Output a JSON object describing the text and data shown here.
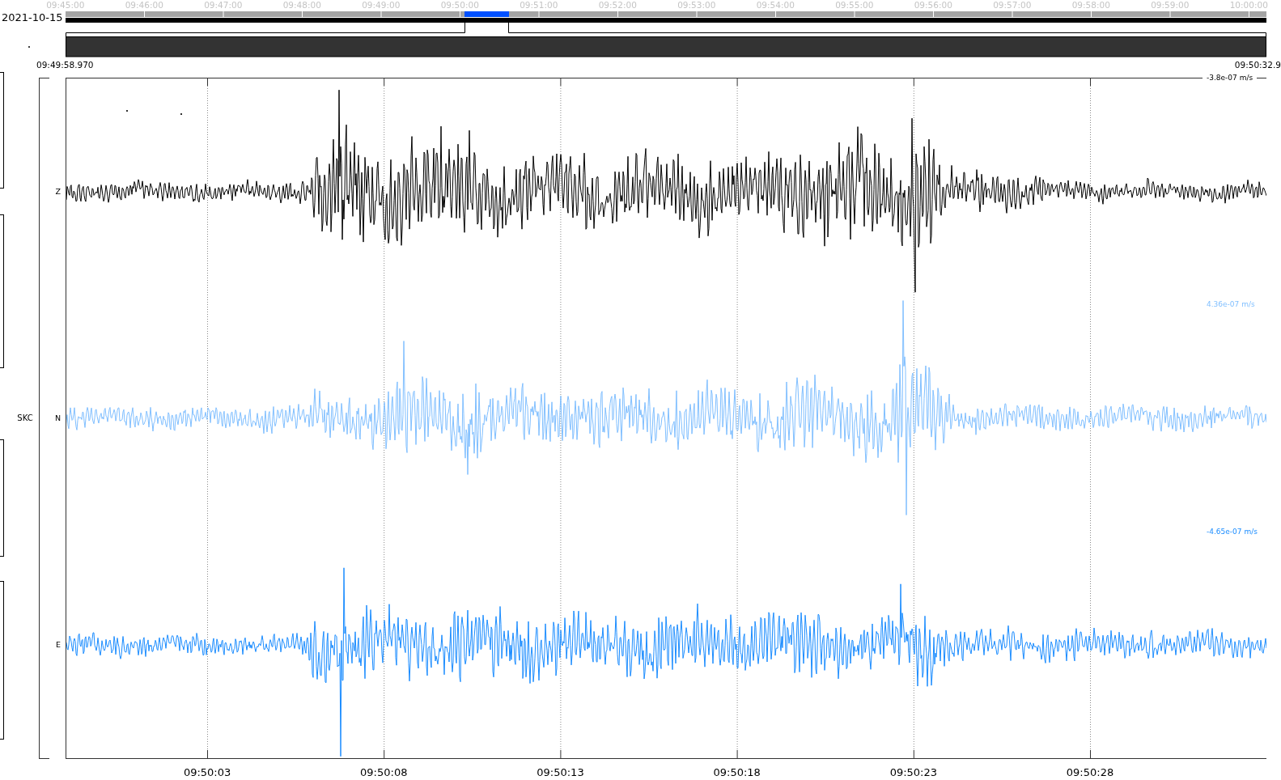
{
  "overview": {
    "date": "2021-10-15",
    "time_labels": [
      "09:45:00",
      "09:46:00",
      "09:47:00",
      "09:48:00",
      "09:49:00",
      "09:50:00",
      "09:51:00",
      "09:52:00",
      "09:53:00",
      "09:54:00",
      "09:55:00",
      "09:56:00",
      "09:57:00",
      "09:58:00",
      "09:59:00",
      "10:00:00"
    ]
  },
  "view": {
    "start_time": "09:49:58.970",
    "end_time": "09:50:32.9"
  },
  "station": {
    "name": "SKC"
  },
  "traces": [
    {
      "channel": "Z",
      "color": "#000000",
      "scale_label": "-3.8e-07 m/s"
    },
    {
      "channel": "N",
      "color": "#80bfff",
      "scale_label": "4.36e-07 m/s"
    },
    {
      "channel": "E",
      "color": "#1a8cff",
      "scale_label": "-4.65e-07 m/s"
    }
  ],
  "time_axis": {
    "ticks": [
      "09:50:03",
      "09:50:08",
      "09:50:13",
      "09:50:18",
      "09:50:23",
      "09:50:28"
    ]
  }
}
